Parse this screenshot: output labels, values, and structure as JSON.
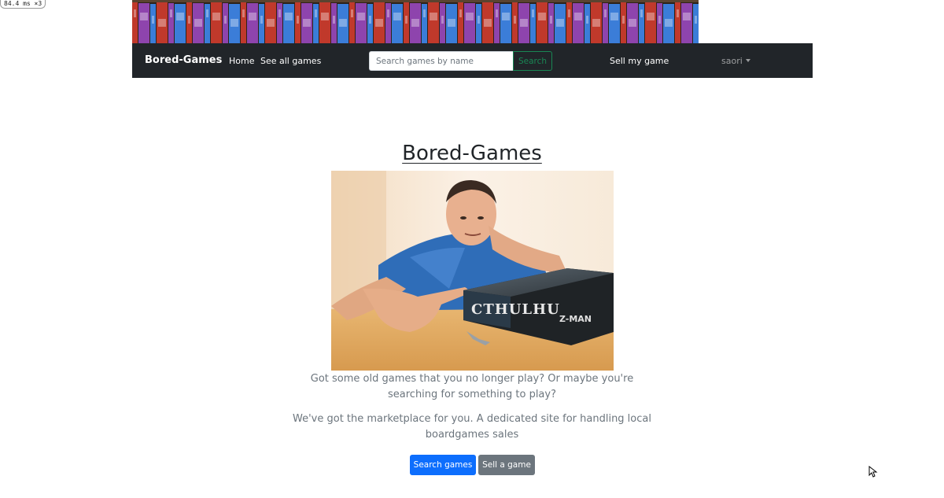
{
  "perf_badge": "84.4 ms ×3",
  "navbar": {
    "brand": "Bored-Games",
    "links": {
      "home": "Home",
      "all_games": "See all games",
      "sell": "Sell my game"
    },
    "search": {
      "placeholder": "Search games by name",
      "value": "",
      "button_label": "Search"
    },
    "user_menu": "saori"
  },
  "main": {
    "title": "Bored-Games",
    "lead_1": [
      "Got some old games that you no longer play? Or maybe you're",
      "searching for something to play?"
    ],
    "lead_2": [
      "We've got the marketplace for you. A dedicated site for handling local",
      "boardgames sales"
    ],
    "buttons": {
      "search_games": "Search games",
      "sell_game": "Sell a game"
    }
  },
  "colors": {
    "navbar_bg": "#212529",
    "primary": "#0d6efd",
    "secondary": "#6c757d",
    "success": "#198754",
    "muted_text": "#6c757d"
  }
}
